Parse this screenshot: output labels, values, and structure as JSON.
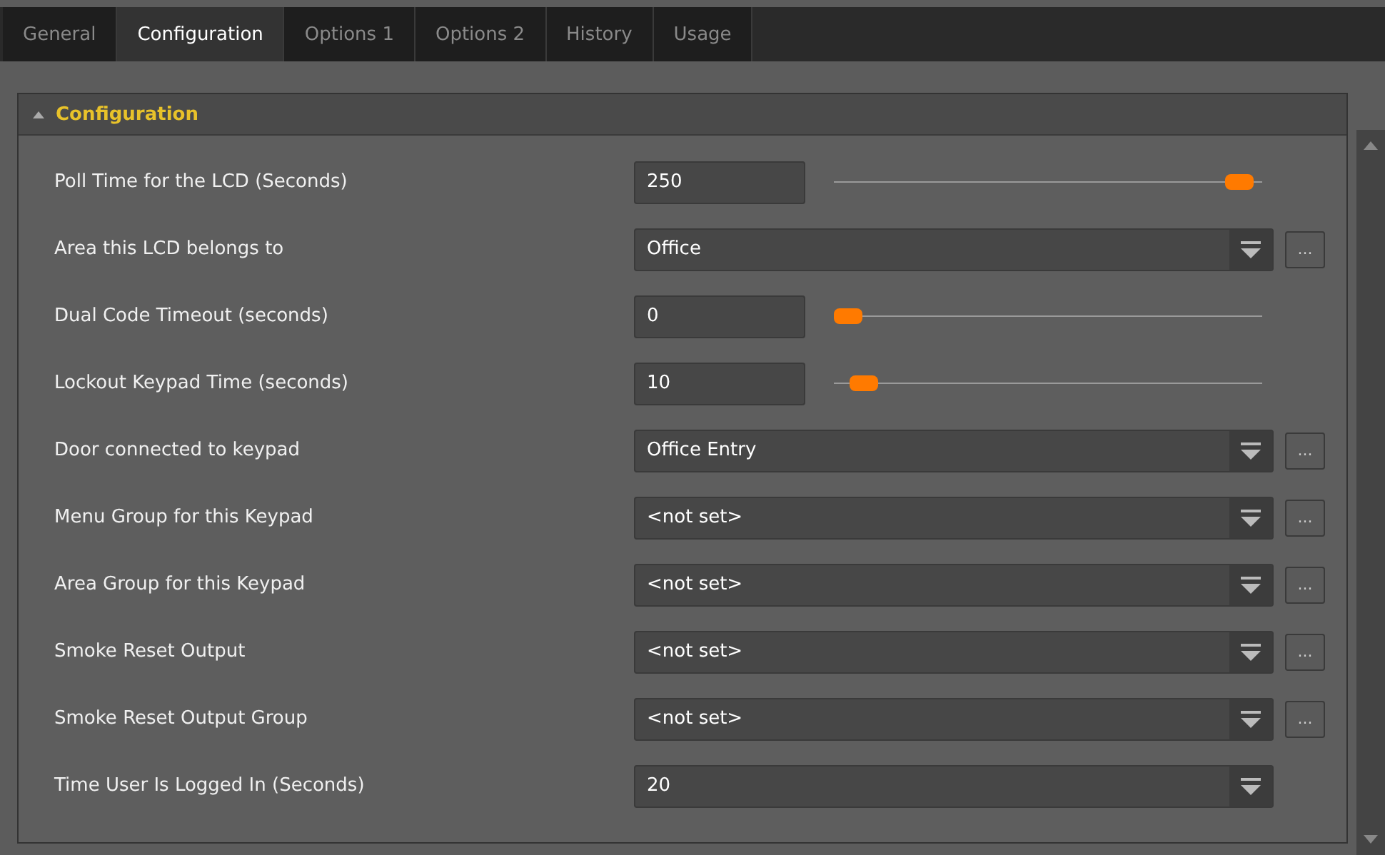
{
  "tabs": [
    {
      "label": "General",
      "selected": false
    },
    {
      "label": "Configuration",
      "selected": true
    },
    {
      "label": "Options 1",
      "selected": false
    },
    {
      "label": "Options 2",
      "selected": false
    },
    {
      "label": "History",
      "selected": false
    },
    {
      "label": "Usage",
      "selected": false
    }
  ],
  "section": {
    "title": "Configuration",
    "expanded": true,
    "rows": [
      {
        "kind": "slider",
        "label": "Poll Time for the LCD (Seconds)",
        "value": "250",
        "level": 0.98
      },
      {
        "kind": "combo",
        "label": "Area this LCD belongs to",
        "value": "Office",
        "browse": "..."
      },
      {
        "kind": "slider",
        "label": "Dual Code Timeout (seconds)",
        "value": "0",
        "level": 0.0
      },
      {
        "kind": "slider",
        "label": "Lockout Keypad Time (seconds)",
        "value": "10",
        "level": 0.04
      },
      {
        "kind": "combo",
        "label": "Door connected to keypad",
        "value": "Office Entry",
        "browse": "..."
      },
      {
        "kind": "combo",
        "label": "Menu Group for this Keypad",
        "value": "<not set>",
        "browse": "..."
      },
      {
        "kind": "combo",
        "label": "Area Group for this Keypad",
        "value": "<not set>",
        "browse": "..."
      },
      {
        "kind": "combo",
        "label": "Smoke Reset Output",
        "value": "<not set>",
        "browse": "..."
      },
      {
        "kind": "combo",
        "label": "Smoke Reset Output Group",
        "value": "<not set>",
        "browse": "..."
      },
      {
        "kind": "combo",
        "label": "Time User Is Logged In (Seconds)",
        "value": "20"
      }
    ]
  }
}
